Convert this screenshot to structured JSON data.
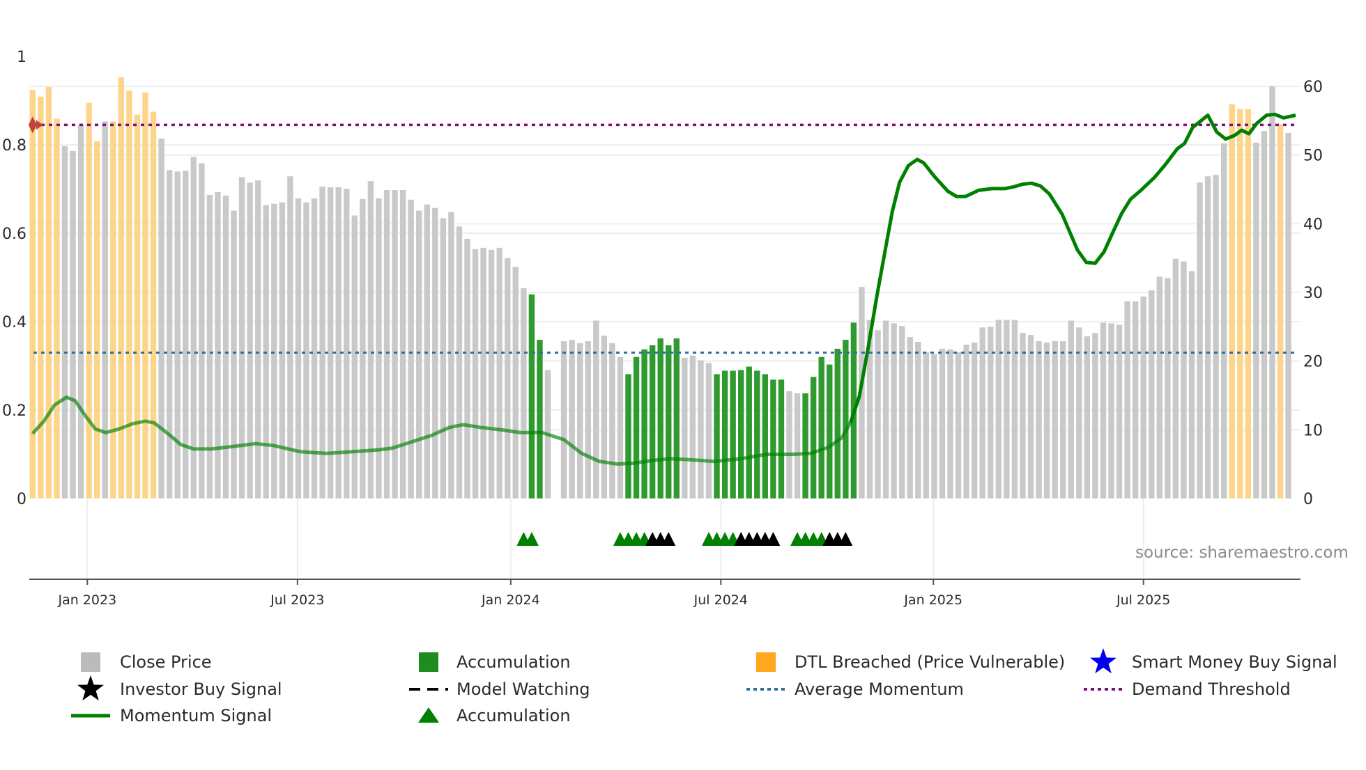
{
  "chart_data": {
    "type": "bar",
    "title": "",
    "xlabel": "",
    "ylabel_left": "",
    "ylabel_right": "",
    "left_axis": {
      "range": [
        0,
        1
      ],
      "ticks": [
        "0",
        "0.2",
        "0.4",
        "0.6",
        "0.8",
        "1"
      ],
      "tick_values": [
        0,
        0.2,
        0.4,
        0.6,
        0.8,
        1
      ]
    },
    "right_axis": {
      "range": [
        0,
        60
      ],
      "ticks": [
        "0",
        "10",
        "20",
        "30",
        "40",
        "50",
        "60"
      ],
      "tick_values": [
        0,
        10,
        20,
        30,
        40,
        50,
        60
      ]
    },
    "x_ticks": [
      {
        "label": "Jan 2023",
        "week": 6.8
      },
      {
        "label": "Jul 2023",
        "week": 32.9
      },
      {
        "label": "Jan 2024",
        "week": 59.4
      },
      {
        "label": "Jul 2024",
        "week": 85.5
      },
      {
        "label": "Jan 2025",
        "week": 111.9
      },
      {
        "label": "Jul 2025",
        "week": 138
      }
    ],
    "grid": true,
    "legend_placement": "bottom",
    "close_price": [
      59.5,
      58.5,
      59.9,
      55.3,
      51.3,
      50.6,
      54.4,
      57.6,
      52,
      54.9,
      54.9,
      61.3,
      59.4,
      55.9,
      59.1,
      56.3,
      52.4,
      47.8,
      47.6,
      47.7,
      49.7,
      48.8,
      44.2,
      44.6,
      44.1,
      41.9,
      46.8,
      46,
      46.3,
      42.7,
      42.9,
      43.1,
      46.9,
      43.7,
      43.1,
      43.7,
      45.4,
      45.3,
      45.3,
      45.1,
      41.2,
      43.6,
      46.2,
      43.7,
      44.9,
      44.9,
      44.9,
      43.5,
      41.9,
      42.8,
      42.3,
      40.8,
      41.7,
      39.6,
      37.8,
      36.3,
      36.5,
      36.2,
      36.5,
      35,
      33.7,
      30.6,
      29.7,
      23.1,
      18.7,
      null,
      22.9,
      23.1,
      22.6,
      22.9,
      25.9,
      23.7,
      22.6,
      20.6,
      18.1,
      20.6,
      21.7,
      22.3,
      23.3,
      22.3,
      23.3,
      20.5,
      20.8,
      20.1,
      19.7,
      18.1,
      18.6,
      18.6,
      18.7,
      19.2,
      18.6,
      18.1,
      17.3,
      17.3,
      15.6,
      15.3,
      15.3,
      17.7,
      20.6,
      19.5,
      21.8,
      23.1,
      25.6,
      30.8,
      26,
      24.5,
      25.9,
      25.5,
      25.1,
      23.5,
      22.8,
      21.3,
      21,
      21.8,
      21.7,
      21.3,
      22.4,
      22.7,
      24.9,
      25,
      26,
      26,
      26,
      24.1,
      23.8,
      22.9,
      22.7,
      22.9,
      22.9,
      25.9,
      24.9,
      23.6,
      24.1,
      25.6,
      25.5,
      25.3,
      28.7,
      28.7,
      29.4,
      30.3,
      32.3,
      32.1,
      34.9,
      34.5,
      33.1,
      46,
      46.9,
      47.1,
      51.7,
      57.4,
      56.7,
      56.7,
      51.8,
      53.5,
      60,
      54.5,
      53.2
    ],
    "bar_state": "oooogggoogooooooggggggggggggggggggggggggggggggggggggggggggggggaaggggggggggaaaaaaaggggaaaaaaaaaggaaaaaaaggggggggggggggggggggggggggggggggggggggggggggggooogggogg",
    "bar_state_legend": {
      "g": "Close Price",
      "a": "Accumulation",
      "o": "DTL Breached (Price Vulnerable)"
    },
    "momentum": [
      [
        0,
        0.147
      ],
      [
        1.4,
        0.175
      ],
      [
        2.7,
        0.211
      ],
      [
        4.2,
        0.229
      ],
      [
        5.3,
        0.221
      ],
      [
        6.4,
        0.191
      ],
      [
        7.8,
        0.157
      ],
      [
        9.1,
        0.149
      ],
      [
        10.7,
        0.157
      ],
      [
        12.4,
        0.169
      ],
      [
        14,
        0.175
      ],
      [
        15.1,
        0.171
      ],
      [
        16.8,
        0.147
      ],
      [
        18.4,
        0.122
      ],
      [
        20,
        0.112
      ],
      [
        22.2,
        0.112
      ],
      [
        25,
        0.118
      ],
      [
        27.7,
        0.124
      ],
      [
        29.9,
        0.12
      ],
      [
        33.2,
        0.106
      ],
      [
        36.5,
        0.102
      ],
      [
        39.8,
        0.106
      ],
      [
        43,
        0.11
      ],
      [
        44.7,
        0.114
      ],
      [
        46.9,
        0.127
      ],
      [
        49.6,
        0.143
      ],
      [
        51.8,
        0.161
      ],
      [
        53.5,
        0.167
      ],
      [
        55.6,
        0.161
      ],
      [
        58.4,
        0.155
      ],
      [
        60.6,
        0.149
      ],
      [
        63.3,
        0.149
      ],
      [
        66,
        0.133
      ],
      [
        68.2,
        0.102
      ],
      [
        70.4,
        0.084
      ],
      [
        72.6,
        0.078
      ],
      [
        74.8,
        0.08
      ],
      [
        77,
        0.086
      ],
      [
        79.2,
        0.09
      ],
      [
        81.4,
        0.088
      ],
      [
        84.7,
        0.084
      ],
      [
        88,
        0.09
      ],
      [
        91.2,
        0.1
      ],
      [
        94.5,
        0.1
      ],
      [
        96.7,
        0.102
      ],
      [
        98.9,
        0.116
      ],
      [
        100.5,
        0.137
      ],
      [
        101.6,
        0.171
      ],
      [
        102.7,
        0.231
      ],
      [
        103.8,
        0.341
      ],
      [
        104.9,
        0.46
      ],
      [
        106,
        0.57
      ],
      [
        106.8,
        0.649
      ],
      [
        107.7,
        0.715
      ],
      [
        108.8,
        0.753
      ],
      [
        109.9,
        0.767
      ],
      [
        110.7,
        0.759
      ],
      [
        112,
        0.729
      ],
      [
        113.7,
        0.695
      ],
      [
        114.8,
        0.683
      ],
      [
        115.9,
        0.683
      ],
      [
        117.5,
        0.697
      ],
      [
        119.2,
        0.701
      ],
      [
        120.8,
        0.701
      ],
      [
        121.9,
        0.705
      ],
      [
        123,
        0.711
      ],
      [
        124.1,
        0.713
      ],
      [
        125.2,
        0.707
      ],
      [
        126.3,
        0.689
      ],
      [
        127.9,
        0.643
      ],
      [
        129.8,
        0.562
      ],
      [
        130.9,
        0.534
      ],
      [
        132,
        0.532
      ],
      [
        133.1,
        0.558
      ],
      [
        134.2,
        0.602
      ],
      [
        135.3,
        0.645
      ],
      [
        136.4,
        0.677
      ],
      [
        137.8,
        0.699
      ],
      [
        139.4,
        0.727
      ],
      [
        140.7,
        0.755
      ],
      [
        142.2,
        0.791
      ],
      [
        143.1,
        0.803
      ],
      [
        144.1,
        0.839
      ],
      [
        146,
        0.867
      ],
      [
        147.1,
        0.829
      ],
      [
        148.2,
        0.813
      ],
      [
        149.3,
        0.821
      ],
      [
        150.2,
        0.833
      ],
      [
        151.1,
        0.825
      ],
      [
        152.1,
        0.849
      ],
      [
        153.3,
        0.867
      ],
      [
        154.3,
        0.869
      ],
      [
        155.4,
        0.861
      ],
      [
        156.9,
        0.867
      ]
    ],
    "demand_threshold": 0.845,
    "average_momentum": 0.33,
    "accumulation_markers": [
      61,
      62,
      73,
      74,
      75,
      76,
      84,
      85,
      86,
      87,
      95,
      96,
      97,
      98
    ],
    "investor_buy_markers": [
      77,
      78,
      79,
      88,
      89,
      90,
      91,
      92,
      99,
      100,
      101
    ],
    "threshold_start_marker_week": 0,
    "legend": [
      {
        "label": "Close Price",
        "icon": "gray-square"
      },
      {
        "label": "Accumulation",
        "icon": "green-square"
      },
      {
        "label": "DTL Breached (Price Vulnerable)",
        "icon": "orange-square"
      },
      {
        "label": "Smart Money Buy Signal",
        "icon": "blue-star"
      },
      {
        "label": "Investor Buy Signal",
        "icon": "black-star"
      },
      {
        "label": "Model Watching",
        "icon": "black-dashed-line"
      },
      {
        "label": "Average Momentum",
        "icon": "blue-dotted-line"
      },
      {
        "label": "Demand Threshold",
        "icon": "purple-dotted-line"
      },
      {
        "label": "Momentum Signal",
        "icon": "green-solid-line"
      },
      {
        "label": "Accumulation",
        "icon": "green-triangle"
      }
    ],
    "source": "source: sharemaestro.com"
  },
  "colors": {
    "gray_bar": "#c9c9c9",
    "orange_bar": "#fdd58a",
    "green_bar": "#2f9a2f",
    "momentum": "#008000",
    "demand": "#7b0f7b",
    "average": "#2e6f9e",
    "grid": "#ebeef4",
    "legend_gray": "#bbbbbb",
    "legend_green": "#1f8c1f",
    "legend_orange": "#ffa81f",
    "legend_blue": "#0000ee"
  }
}
